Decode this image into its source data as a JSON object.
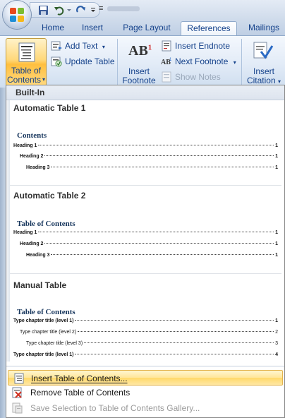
{
  "titlebar": {
    "qat_separator": "≡"
  },
  "tabs": [
    {
      "label": "Home",
      "active": false
    },
    {
      "label": "Insert",
      "active": false
    },
    {
      "label": "Page Layout",
      "active": false
    },
    {
      "label": "References",
      "active": true
    },
    {
      "label": "Mailings",
      "active": false
    }
  ],
  "ribbon": {
    "toc_button": {
      "line1": "Table of",
      "line2": "Contents",
      "arrow": "▾"
    },
    "add_text": {
      "label": "Add Text",
      "arrow": "▾"
    },
    "update_table": {
      "label": "Update Table"
    },
    "insert_footnote": {
      "line1": "Insert",
      "line2": "Footnote",
      "glyph": "AB",
      "sup": "1"
    },
    "insert_endnote": {
      "label": "Insert Endnote"
    },
    "next_footnote": {
      "label": "Next Footnote",
      "arrow": "▾"
    },
    "show_notes": {
      "label": "Show Notes"
    },
    "insert_citation": {
      "line1": "Insert",
      "line2": "Citation",
      "arrow": "▾"
    }
  },
  "gallery": {
    "header": "Built-In",
    "items": [
      {
        "title": "Automatic Table 1",
        "heading": "Contents",
        "lines": [
          {
            "text": "Heading 1",
            "page": "1",
            "level": 1
          },
          {
            "text": "Heading 2",
            "page": "1",
            "level": 2
          },
          {
            "text": "Heading 3",
            "page": "1",
            "level": 3
          }
        ]
      },
      {
        "title": "Automatic Table 2",
        "heading": "Table of Contents",
        "lines": [
          {
            "text": "Heading 1",
            "page": "1",
            "level": 1
          },
          {
            "text": "Heading 2",
            "page": "1",
            "level": 2
          },
          {
            "text": "Heading 3",
            "page": "1",
            "level": 3
          }
        ]
      },
      {
        "title": "Manual Table",
        "heading": "Table of Contents",
        "lines": [
          {
            "text": "Type chapter title (level 1)",
            "page": "1",
            "level": 1
          },
          {
            "text": "Type chapter title (level 2)",
            "page": "2",
            "level": 2
          },
          {
            "text": "Type chapter title (level 3)",
            "page": "3",
            "level": 3
          },
          {
            "text": "Type chapter title (level 1)",
            "page": "4",
            "level": 1
          }
        ]
      }
    ]
  },
  "menu": [
    {
      "label": "Insert Table of Contents...",
      "hotkey_index": 0,
      "state": "hover"
    },
    {
      "label": "Remove Table of Contents",
      "hotkey_index": 0,
      "state": "normal"
    },
    {
      "label": "Save Selection to Table of Contents Gallery...",
      "hotkey_index": 0,
      "state": "disabled"
    }
  ],
  "colors": {
    "accent_text": "#15428b",
    "toc_heading": "#17365d",
    "hover_fill": "#ffe69a"
  }
}
